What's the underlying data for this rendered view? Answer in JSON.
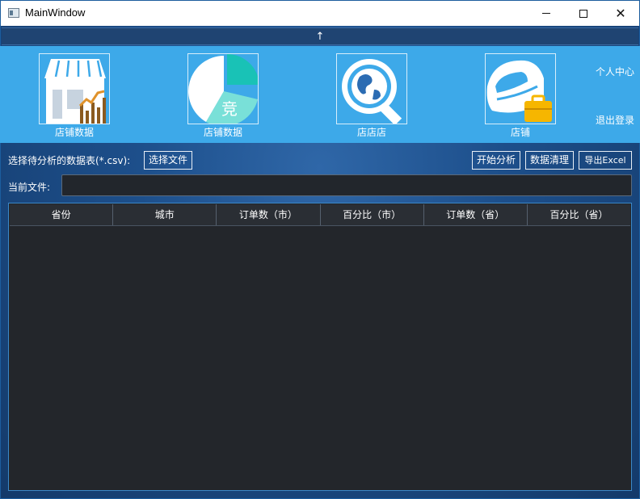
{
  "window": {
    "title": "MainWindow"
  },
  "top_bar": {
    "arrow": "↑"
  },
  "nav": {
    "tiles": [
      {
        "label": "店铺数据"
      },
      {
        "label": "店铺数据",
        "overlay_text": "竞"
      },
      {
        "label": "店店店"
      },
      {
        "label": "店铺"
      }
    ],
    "side_links": {
      "personal_center": "个人中心",
      "logout": "退出登录"
    }
  },
  "toolbar": {
    "select_label": "选择待分析的数据表(*.csv):",
    "choose_file": "选择文件",
    "start_analysis": "开始分析",
    "data_cleaning": "数据清理",
    "export_excel": "导出Excel"
  },
  "current_file": {
    "label": "当前文件:",
    "value": ""
  },
  "table": {
    "columns": [
      "省份",
      "城市",
      "订单数（市）",
      "百分比（市）",
      "订单数（省）",
      "百分比（省）"
    ]
  },
  "colors": {
    "nav_background": "#3da9e9",
    "top_bar": "#1f4472",
    "table_background": "#23262b"
  }
}
